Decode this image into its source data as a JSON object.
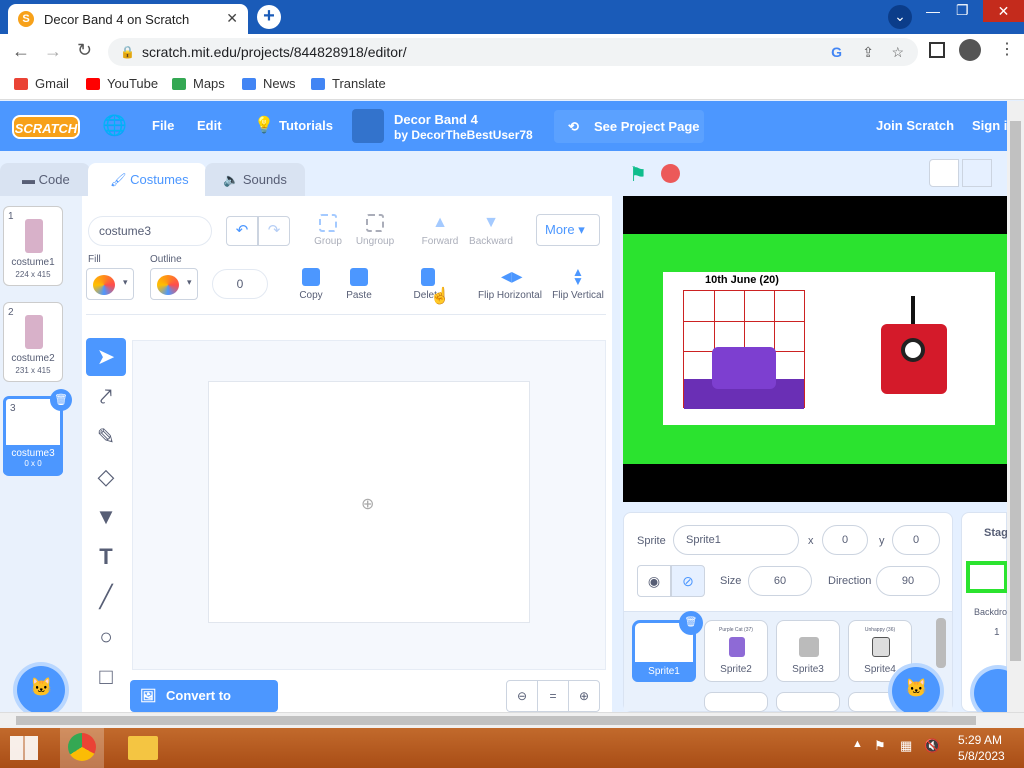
{
  "browser": {
    "tab_title": "Decor Band 4 on Scratch",
    "url": "scratch.mit.edu/projects/844828918/editor/",
    "bookmarks": [
      "Gmail",
      "YouTube",
      "Maps",
      "News",
      "Translate"
    ]
  },
  "menu": {
    "logo": "SCRATCH",
    "file": "File",
    "edit": "Edit",
    "tutorials": "Tutorials",
    "project_title": "Decor Band 4",
    "project_author": "by DecorTheBestUser78",
    "see_project": "See Project Page",
    "join": "Join Scratch",
    "signin": "Sign in"
  },
  "tabs": {
    "code": "Code",
    "costumes": "Costumes",
    "sounds": "Sounds"
  },
  "costumes": [
    {
      "num": "1",
      "name": "costume1",
      "size": "224 x 415"
    },
    {
      "num": "2",
      "name": "costume2",
      "size": "231 x 415"
    },
    {
      "num": "3",
      "name": "costume3",
      "size": "0 x 0"
    }
  ],
  "paint": {
    "costume_name": "costume3",
    "group": "Group",
    "ungroup": "Ungroup",
    "forward": "Forward",
    "backward": "Backward",
    "more": "More",
    "fill_label": "Fill",
    "outline_label": "Outline",
    "outline_width": "0",
    "copy": "Copy",
    "paste": "Paste",
    "delete": "Delete",
    "flip_h": "Flip Horizontal",
    "flip_v": "Flip Vertical",
    "convert": "Convert to Bitmap",
    "zoom_reset": "="
  },
  "stage": {
    "board_text": "10th June (20)"
  },
  "sprite_info": {
    "sprite_label": "Sprite",
    "sprite_name": "Sprite1",
    "x_label": "x",
    "x": "0",
    "y_label": "y",
    "y": "0",
    "size_label": "Size",
    "size": "60",
    "direction_label": "Direction",
    "direction": "90"
  },
  "sprites": [
    {
      "name": "Sprite1",
      "caption": ""
    },
    {
      "name": "Sprite2",
      "caption": "Purple Cat (37)"
    },
    {
      "name": "Sprite3",
      "caption": ""
    },
    {
      "name": "Sprite4",
      "caption": "Unhappy (36)"
    }
  ],
  "stage_panel": {
    "title": "Stage",
    "backdrops_label": "Backdrops",
    "backdrops_count": "1"
  },
  "taskbar": {
    "time": "5:29 AM",
    "date": "5/8/2023"
  },
  "colors": {
    "scratch_blue": "#4c97ff",
    "menu_blue": "#4c97ff",
    "stage_green": "#2be32f",
    "taskbar": "#b3541e"
  }
}
